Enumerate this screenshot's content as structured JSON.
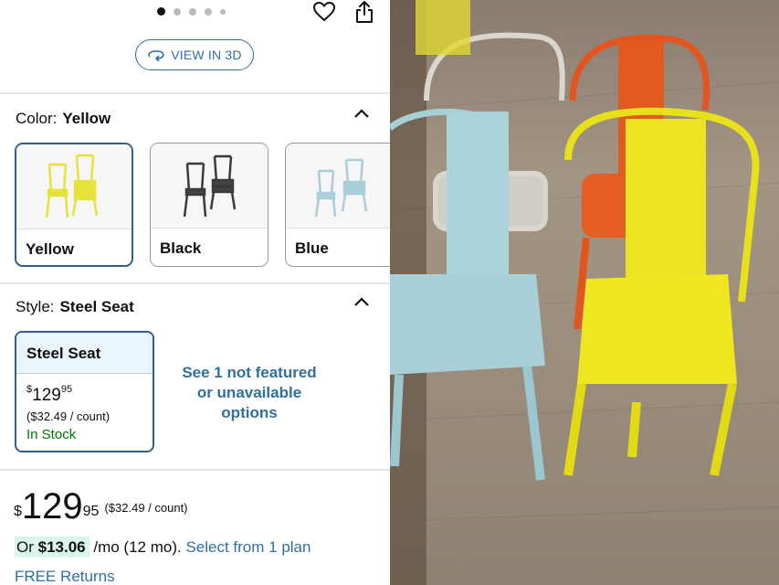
{
  "gallery": {
    "dots": 5,
    "active_index": 0
  },
  "actions": {
    "view3d_label": "VIEW IN 3D"
  },
  "color": {
    "label": "Color:",
    "selected": "Yellow",
    "options": [
      {
        "name": "Yellow",
        "hex": "#e6e23a"
      },
      {
        "name": "Black",
        "hex": "#3a3a3a"
      },
      {
        "name": "Blue",
        "hex": "#a9cfd8"
      }
    ]
  },
  "style": {
    "label": "Style:",
    "selected": "Steel Seat",
    "card": {
      "name": "Steel Seat",
      "price_whole": "129",
      "price_fraction": "95",
      "currency": "$",
      "per_count": "($32.49 / count)",
      "availability": "In Stock"
    },
    "more_options": "See 1 not featured or unavailable options"
  },
  "price": {
    "currency": "$",
    "whole": "129",
    "fraction": "95",
    "per_count": "($32.49 / count)"
  },
  "financing": {
    "prefix": "Or",
    "amount": "$13.06",
    "terms": "/mo (12 mo).",
    "link": "Select from 1 plan"
  },
  "returns": "FREE Returns",
  "colors": {
    "link": "#2f6f9f",
    "selected_border": "#2f5f8a",
    "in_stock": "#007600",
    "highlight": "#d9f5ee"
  },
  "product_photo": {
    "chairs": [
      "white",
      "orange",
      "blue",
      "yellow"
    ]
  }
}
